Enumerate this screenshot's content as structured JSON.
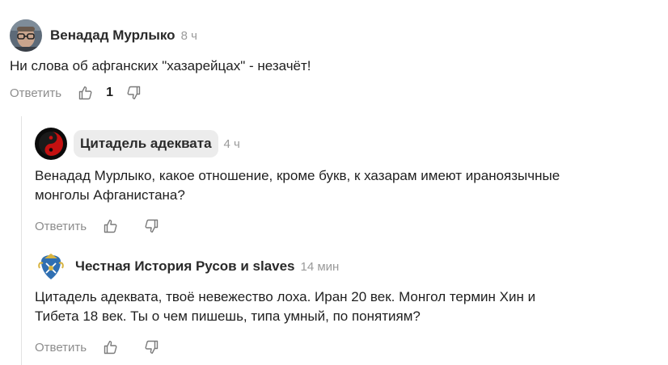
{
  "comments": [
    {
      "author": "Венадад Мурлыко",
      "time": "8 ч",
      "text": "Ни слова об афганских \"хазарейцах\" - незачёт!",
      "reply_label": "Ответить",
      "likes": "1"
    },
    {
      "author": "Цитадель адеквата",
      "time": "4 ч",
      "text_line1": "Венадад Мурлыко, какое отношение, кроме букв, к хазарам имеют ираноязычные",
      "text_line2": "монголы Афганистана?",
      "reply_label": "Ответить"
    },
    {
      "author": "Честная История Русов и slaves",
      "time": "14 мин",
      "text_line1": "Цитадель адеквата, твоё невежество лоха. Иран 20 век. Монгол термин Хин и",
      "text_line2": "Тибета 18 век. Ты о чем пишешь, типа умный, по понятиям?",
      "reply_label": "Ответить"
    }
  ],
  "icons": {
    "like": "thumbs-up-icon",
    "dislike": "thumbs-down-icon"
  },
  "colors": {
    "muted": "#8d8d8d",
    "pill": "#ececec",
    "thread_line": "#e3e3e3"
  }
}
